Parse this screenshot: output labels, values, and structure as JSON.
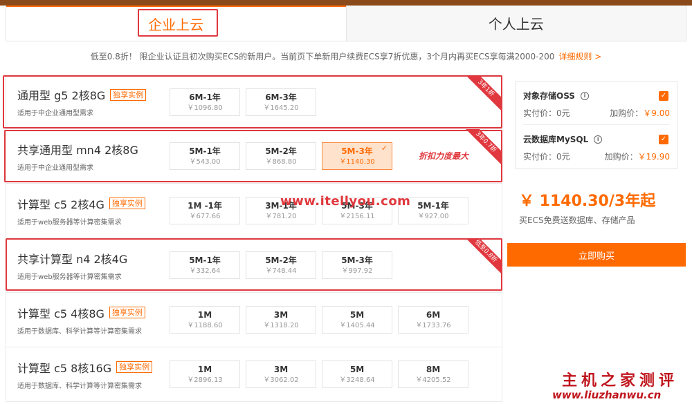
{
  "tabs": [
    {
      "label": "企业上云",
      "active": true
    },
    {
      "label": "个人上云",
      "active": false
    }
  ],
  "notice": {
    "text": "低至0.8折！ 限企业认证且初次购买ECS的新用户。当前页下单新用户续费ECS享7折优惠，3个月内再买ECS享每满2000-200",
    "link": "详细规则 >"
  },
  "rows": [
    {
      "title": "通用型 g5 2核8G",
      "badge": "独享实例",
      "sub": "适用于中企业通用型需求",
      "ribbon": "3年1折",
      "options": [
        {
          "label": "6M-1年",
          "price": "￥1096.80"
        },
        {
          "label": "6M-3年",
          "price": "￥1645.20"
        }
      ]
    },
    {
      "title": "共享通用型 mn4 2核8G",
      "badge": "",
      "sub": "适用于中企业通用型需求",
      "ribbon": "3年0.7折",
      "options": [
        {
          "label": "5M-1年",
          "price": "￥543.00"
        },
        {
          "label": "5M-2年",
          "price": "￥868.80"
        },
        {
          "label": "5M-3年",
          "price": "￥1140.30",
          "selected": true
        }
      ]
    },
    {
      "title": "计算型 c5 2核4G",
      "badge": "独享实例",
      "sub": "适用于web服务器等计算密集需求",
      "ribbon": "",
      "options": [
        {
          "label": "1M -1年",
          "price": "￥677.66"
        },
        {
          "label": "3M-1年",
          "price": "￥781.20"
        },
        {
          "label": "5M-3年",
          "price": "￥2156.11"
        },
        {
          "label": "5M-1年",
          "price": "￥927.00"
        }
      ]
    },
    {
      "title": "共享计算型 n4 2核4G",
      "badge": "",
      "sub": "适用于web服务器等计算密集需求",
      "ribbon": "低至0.8折",
      "options": [
        {
          "label": "5M-1年",
          "price": "￥332.64"
        },
        {
          "label": "5M-2年",
          "price": "￥748.44"
        },
        {
          "label": "5M-3年",
          "price": "￥997.92"
        }
      ]
    },
    {
      "title": "计算型 c5 4核8G",
      "badge": "独享实例",
      "sub": "适用于数据库、科学计算等计算密集需求",
      "ribbon": "",
      "options": [
        {
          "label": "1M",
          "price": "￥1188.60"
        },
        {
          "label": "3M",
          "price": "￥1318.20"
        },
        {
          "label": "5M",
          "price": "￥1405.44"
        },
        {
          "label": "6M",
          "price": "￥1733.76"
        }
      ]
    },
    {
      "title": "计算型 c5 8核16G",
      "badge": "独享实例",
      "sub": "适用于数据库、科学计算等计算密集需求",
      "ribbon": "",
      "options": [
        {
          "label": "1M",
          "price": "￥2896.13"
        },
        {
          "label": "3M",
          "price": "￥3062.02"
        },
        {
          "label": "5M",
          "price": "￥3248.64"
        },
        {
          "label": "8M",
          "price": "￥4205.52"
        }
      ]
    }
  ],
  "promo_text": "折扣力度最大",
  "watermark": "www.itellyou.com",
  "addons": [
    {
      "name": "对象存储OSS",
      "paid_label": "实付价：0元",
      "add_label": "加购价：",
      "add_price": "￥9.00"
    },
    {
      "name": "云数据库MySQL",
      "paid_label": "实付价：0元",
      "add_label": "加购价：",
      "add_price": "￥19.90"
    }
  ],
  "total": {
    "price": "￥ 1140.30/3年起",
    "sub": "买ECS免费送数据库、存储产品"
  },
  "buy_label": "立即购买",
  "brand": {
    "name": "主机之家测评",
    "url": "www.liuzhanwu.cn"
  },
  "colors": {
    "accent": "#ff6a00",
    "highlight": "#e0383e"
  }
}
